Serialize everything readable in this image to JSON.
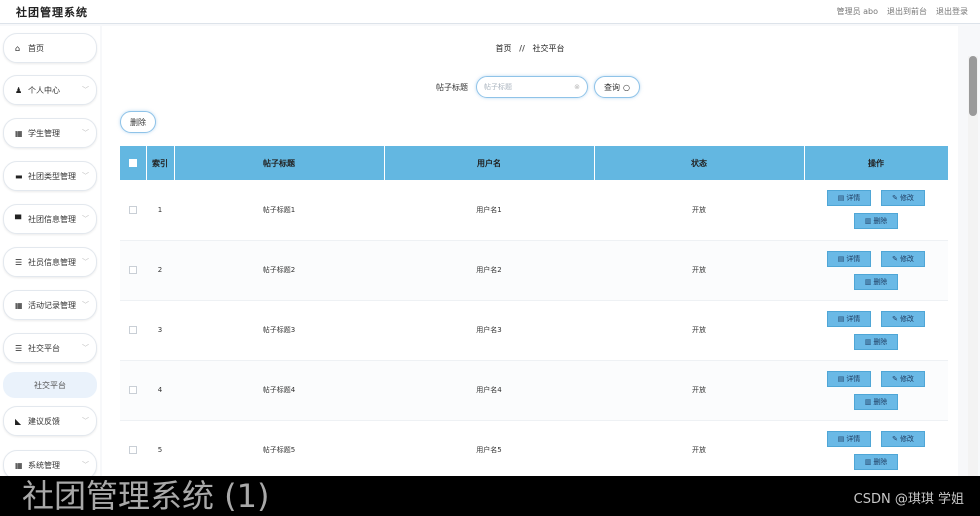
{
  "app": {
    "title": "社团管理系统"
  },
  "top_links": [
    "管理员 abo",
    "退出到前台",
    "退出登录"
  ],
  "sidebar": {
    "items": [
      {
        "icon": "home-icon",
        "glyph": "⌂",
        "label": "首页",
        "chevron": false
      },
      {
        "icon": "user-icon",
        "glyph": "♟",
        "label": "个人中心",
        "chevron": true
      },
      {
        "icon": "grid-icon",
        "glyph": "▦",
        "label": "学生管理",
        "chevron": true
      },
      {
        "icon": "card-icon",
        "glyph": "▬",
        "label": "社团类型管理",
        "chevron": true
      },
      {
        "icon": "folder-icon",
        "glyph": "▀",
        "label": "社团信息管理",
        "chevron": true
      },
      {
        "icon": "list-icon",
        "glyph": "☰",
        "label": "社员信息管理",
        "chevron": true
      },
      {
        "icon": "grid-icon",
        "glyph": "▦",
        "label": "活动记录管理",
        "chevron": true
      },
      {
        "icon": "list-icon",
        "glyph": "☰",
        "label": "社交平台",
        "chevron": true
      },
      {
        "icon": "feedback-icon",
        "glyph": "◣",
        "label": "建议反馈",
        "chevron": true
      },
      {
        "icon": "grid-icon",
        "glyph": "▦",
        "label": "系统管理",
        "chevron": true
      }
    ],
    "active_sub": "社交平台"
  },
  "breadcrumb": {
    "home": "首页",
    "separator": "//",
    "current": "社交平台"
  },
  "search": {
    "label": "帖子标题",
    "placeholder": "帖子标题",
    "value": "",
    "button": "查询"
  },
  "toolbar": {
    "delete_label": "删除"
  },
  "table": {
    "headers": {
      "index": "索引",
      "title": "帖子标题",
      "user": "用户名",
      "status": "状态",
      "actions": "操作"
    },
    "rows": [
      {
        "index": "1",
        "title": "帖子标题1",
        "user": "用户名1",
        "status": "开放"
      },
      {
        "index": "2",
        "title": "帖子标题2",
        "user": "用户名2",
        "status": "开放"
      },
      {
        "index": "3",
        "title": "帖子标题3",
        "user": "用户名3",
        "status": "开放"
      },
      {
        "index": "4",
        "title": "帖子标题4",
        "user": "用户名4",
        "status": "开放"
      },
      {
        "index": "5",
        "title": "帖子标题5",
        "user": "用户名5",
        "status": "开放"
      }
    ],
    "actions": {
      "detail": "详情",
      "edit": "修改",
      "delete": "删除"
    }
  },
  "caption": {
    "title": "社团管理系统 (1)",
    "credit": "CSDN @琪琪 学姐"
  },
  "colors": {
    "header_blue": "#63b7e1",
    "button_blue": "#6ab9e6",
    "accent_border": "#8fc3e8"
  }
}
